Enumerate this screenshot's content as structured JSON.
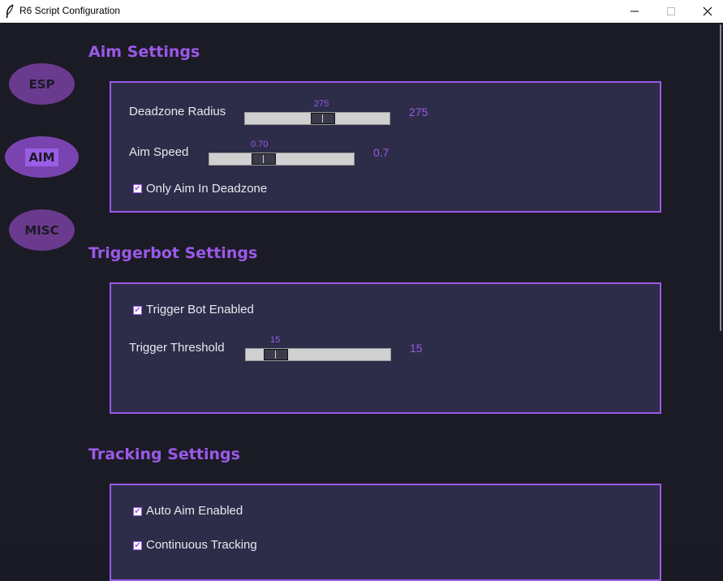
{
  "window": {
    "title": "R6 Script Configuration",
    "icon": "feather-icon"
  },
  "nav": {
    "esp": "ESP",
    "aim": "AIM",
    "misc": "MISC",
    "active": "AIM"
  },
  "aim_settings": {
    "title": "Aim Settings",
    "deadzone_label": "Deadzone Radius",
    "deadzone_value_text": "275",
    "deadzone_tick": "275",
    "deadzone_fraction": 0.55,
    "aim_speed_label": "Aim Speed",
    "aim_speed_value_text": "0.7",
    "aim_speed_tick": "0.70",
    "aim_speed_fraction": 0.35,
    "only_aim_label": "Only Aim In Deadzone",
    "only_aim_checked": true
  },
  "triggerbot_settings": {
    "title": "Triggerbot Settings",
    "enabled_label": "Trigger Bot Enabled",
    "enabled_checked": true,
    "threshold_label": "Trigger Threshold",
    "threshold_value_text": "15",
    "threshold_tick": "15",
    "threshold_fraction": 0.15
  },
  "tracking_settings": {
    "title": "Tracking Settings",
    "auto_aim_label": "Auto Aim Enabled",
    "auto_aim_checked": true,
    "continuous_label": "Continuous Tracking",
    "continuous_checked": true
  },
  "colors": {
    "accent": "#9b59e8",
    "panel_bg": "#2d2d4a",
    "window_bg": "#1b1b25"
  }
}
